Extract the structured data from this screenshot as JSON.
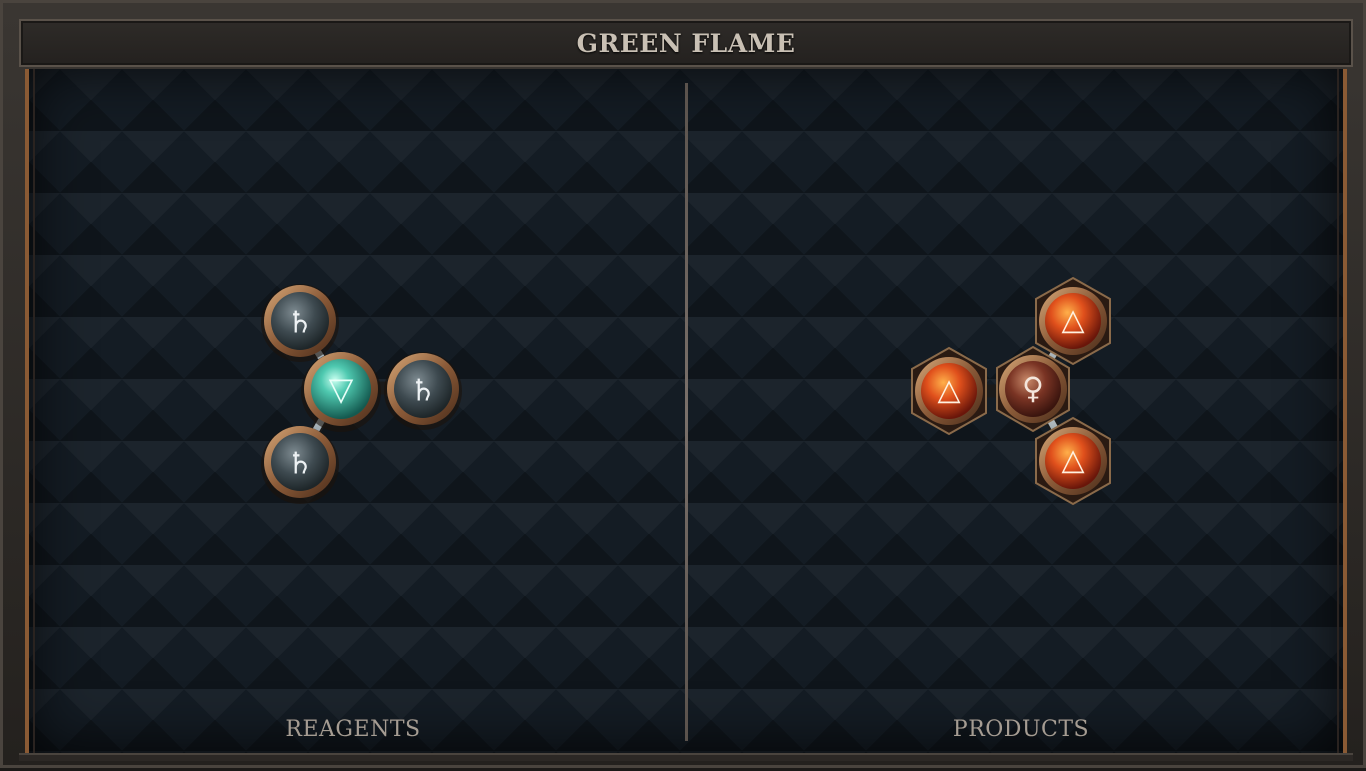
{
  "title": "GREEN FLAME",
  "reagents": {
    "label": "REAGENTS",
    "atoms": [
      {
        "id": "r-center",
        "element": "water",
        "glyph": "▽",
        "color": "teal"
      },
      {
        "id": "r-top",
        "element": "salt",
        "glyph": "♄",
        "color": "grey"
      },
      {
        "id": "r-right",
        "element": "salt",
        "glyph": "♄",
        "color": "grey"
      },
      {
        "id": "r-bottom",
        "element": "salt",
        "glyph": "♄",
        "color": "grey"
      }
    ]
  },
  "products": {
    "label": "PRODUCTS",
    "atoms": [
      {
        "id": "p-center",
        "element": "copper",
        "glyph": "♀",
        "color": "bronze"
      },
      {
        "id": "p-left",
        "element": "fire",
        "glyph": "△",
        "color": "orange"
      },
      {
        "id": "p-top",
        "element": "fire",
        "glyph": "△",
        "color": "orange"
      },
      {
        "id": "p-bottom",
        "element": "fire",
        "glyph": "△",
        "color": "orange"
      }
    ]
  },
  "colors": {
    "frame": "#3a3632",
    "board": "#141c24",
    "accent_copper": "#8a5a34",
    "title_text": "#c9c0b4"
  }
}
